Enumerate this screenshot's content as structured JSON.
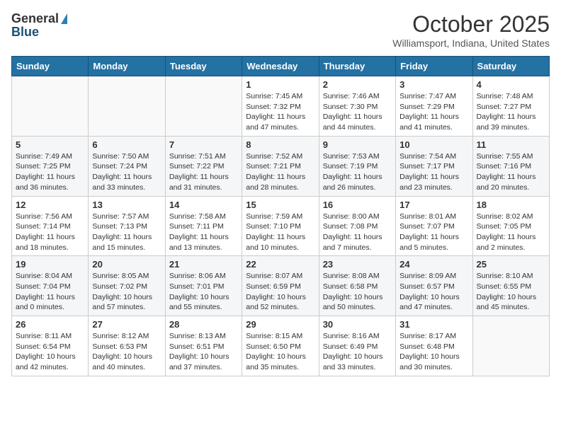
{
  "header": {
    "logo_general": "General",
    "logo_blue": "Blue",
    "month": "October 2025",
    "location": "Williamsport, Indiana, United States"
  },
  "days_of_week": [
    "Sunday",
    "Monday",
    "Tuesday",
    "Wednesday",
    "Thursday",
    "Friday",
    "Saturday"
  ],
  "weeks": [
    [
      {
        "day": "",
        "content": ""
      },
      {
        "day": "",
        "content": ""
      },
      {
        "day": "",
        "content": ""
      },
      {
        "day": "1",
        "content": "Sunrise: 7:45 AM\nSunset: 7:32 PM\nDaylight: 11 hours and 47 minutes."
      },
      {
        "day": "2",
        "content": "Sunrise: 7:46 AM\nSunset: 7:30 PM\nDaylight: 11 hours and 44 minutes."
      },
      {
        "day": "3",
        "content": "Sunrise: 7:47 AM\nSunset: 7:29 PM\nDaylight: 11 hours and 41 minutes."
      },
      {
        "day": "4",
        "content": "Sunrise: 7:48 AM\nSunset: 7:27 PM\nDaylight: 11 hours and 39 minutes."
      }
    ],
    [
      {
        "day": "5",
        "content": "Sunrise: 7:49 AM\nSunset: 7:25 PM\nDaylight: 11 hours and 36 minutes."
      },
      {
        "day": "6",
        "content": "Sunrise: 7:50 AM\nSunset: 7:24 PM\nDaylight: 11 hours and 33 minutes."
      },
      {
        "day": "7",
        "content": "Sunrise: 7:51 AM\nSunset: 7:22 PM\nDaylight: 11 hours and 31 minutes."
      },
      {
        "day": "8",
        "content": "Sunrise: 7:52 AM\nSunset: 7:21 PM\nDaylight: 11 hours and 28 minutes."
      },
      {
        "day": "9",
        "content": "Sunrise: 7:53 AM\nSunset: 7:19 PM\nDaylight: 11 hours and 26 minutes."
      },
      {
        "day": "10",
        "content": "Sunrise: 7:54 AM\nSunset: 7:17 PM\nDaylight: 11 hours and 23 minutes."
      },
      {
        "day": "11",
        "content": "Sunrise: 7:55 AM\nSunset: 7:16 PM\nDaylight: 11 hours and 20 minutes."
      }
    ],
    [
      {
        "day": "12",
        "content": "Sunrise: 7:56 AM\nSunset: 7:14 PM\nDaylight: 11 hours and 18 minutes."
      },
      {
        "day": "13",
        "content": "Sunrise: 7:57 AM\nSunset: 7:13 PM\nDaylight: 11 hours and 15 minutes."
      },
      {
        "day": "14",
        "content": "Sunrise: 7:58 AM\nSunset: 7:11 PM\nDaylight: 11 hours and 13 minutes."
      },
      {
        "day": "15",
        "content": "Sunrise: 7:59 AM\nSunset: 7:10 PM\nDaylight: 11 hours and 10 minutes."
      },
      {
        "day": "16",
        "content": "Sunrise: 8:00 AM\nSunset: 7:08 PM\nDaylight: 11 hours and 7 minutes."
      },
      {
        "day": "17",
        "content": "Sunrise: 8:01 AM\nSunset: 7:07 PM\nDaylight: 11 hours and 5 minutes."
      },
      {
        "day": "18",
        "content": "Sunrise: 8:02 AM\nSunset: 7:05 PM\nDaylight: 11 hours and 2 minutes."
      }
    ],
    [
      {
        "day": "19",
        "content": "Sunrise: 8:04 AM\nSunset: 7:04 PM\nDaylight: 11 hours and 0 minutes."
      },
      {
        "day": "20",
        "content": "Sunrise: 8:05 AM\nSunset: 7:02 PM\nDaylight: 10 hours and 57 minutes."
      },
      {
        "day": "21",
        "content": "Sunrise: 8:06 AM\nSunset: 7:01 PM\nDaylight: 10 hours and 55 minutes."
      },
      {
        "day": "22",
        "content": "Sunrise: 8:07 AM\nSunset: 6:59 PM\nDaylight: 10 hours and 52 minutes."
      },
      {
        "day": "23",
        "content": "Sunrise: 8:08 AM\nSunset: 6:58 PM\nDaylight: 10 hours and 50 minutes."
      },
      {
        "day": "24",
        "content": "Sunrise: 8:09 AM\nSunset: 6:57 PM\nDaylight: 10 hours and 47 minutes."
      },
      {
        "day": "25",
        "content": "Sunrise: 8:10 AM\nSunset: 6:55 PM\nDaylight: 10 hours and 45 minutes."
      }
    ],
    [
      {
        "day": "26",
        "content": "Sunrise: 8:11 AM\nSunset: 6:54 PM\nDaylight: 10 hours and 42 minutes."
      },
      {
        "day": "27",
        "content": "Sunrise: 8:12 AM\nSunset: 6:53 PM\nDaylight: 10 hours and 40 minutes."
      },
      {
        "day": "28",
        "content": "Sunrise: 8:13 AM\nSunset: 6:51 PM\nDaylight: 10 hours and 37 minutes."
      },
      {
        "day": "29",
        "content": "Sunrise: 8:15 AM\nSunset: 6:50 PM\nDaylight: 10 hours and 35 minutes."
      },
      {
        "day": "30",
        "content": "Sunrise: 8:16 AM\nSunset: 6:49 PM\nDaylight: 10 hours and 33 minutes."
      },
      {
        "day": "31",
        "content": "Sunrise: 8:17 AM\nSunset: 6:48 PM\nDaylight: 10 hours and 30 minutes."
      },
      {
        "day": "",
        "content": ""
      }
    ]
  ]
}
